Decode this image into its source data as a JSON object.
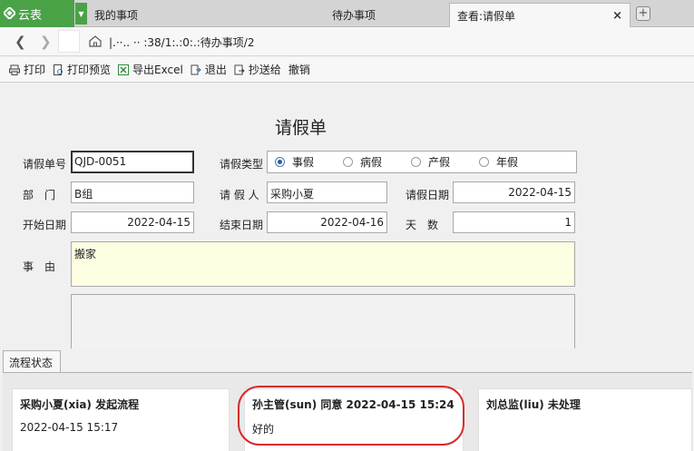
{
  "tabs": {
    "app_name": "云表",
    "items": [
      "我的事项",
      "待办事项",
      "查看:请假单"
    ],
    "close_symbol": "×",
    "new_tab_symbol": "+"
  },
  "address": {
    "url": "|.··.. ·· :38/1:.:0:.:待办事项/2"
  },
  "toolbar": {
    "print": "打印",
    "print_preview": "打印预览",
    "export_excel": "导出Excel",
    "exit": "退出",
    "cc": "抄送给",
    "revoke": "撤销"
  },
  "form": {
    "title": "请假单",
    "labels": {
      "leave_no": "请假单号",
      "leave_type": "请假类型",
      "department": "部　门",
      "applicant": "请 假 人",
      "apply_date": "请假日期",
      "start_date": "开始日期",
      "end_date": "结束日期",
      "days": "天　数",
      "reason": "事　由"
    },
    "values": {
      "leave_no": "QJD-0051",
      "department": "B组",
      "applicant": "采购小夏",
      "apply_date": "2022-04-15",
      "start_date": "2022-04-15",
      "end_date": "2022-04-16",
      "days": "1",
      "reason": "搬家"
    },
    "leave_types": [
      "事假",
      "病假",
      "产假",
      "年假"
    ],
    "selected_type": "事假"
  },
  "flow": {
    "tab_label": "流程状态",
    "cards": [
      {
        "head": "采购小夏(xia)  发起流程",
        "sub": "2022-04-15 15:17"
      },
      {
        "head": "孙主管(sun) 同意 2022-04-15 15:24",
        "sub": "好的"
      },
      {
        "head": "刘总监(liu) 未处理",
        "sub": ""
      }
    ],
    "highlight_color": "#d62b2b"
  },
  "colors": {
    "brand_green": "#4aa247"
  }
}
